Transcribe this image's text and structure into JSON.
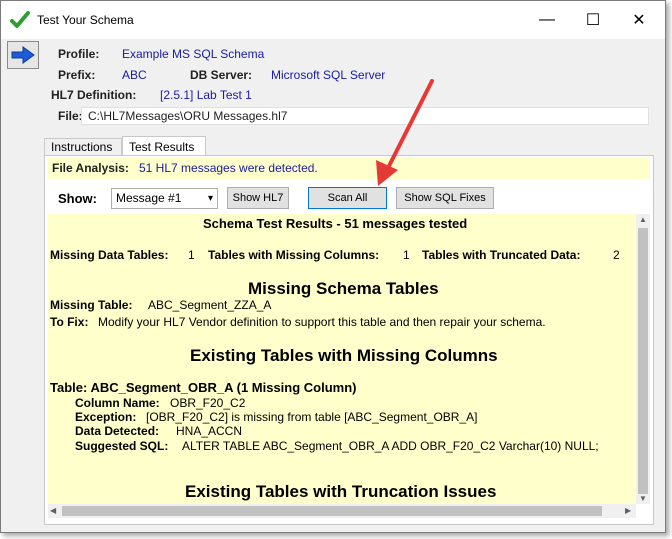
{
  "window": {
    "title": "Test Your Schema",
    "controls": {
      "minimize": "—",
      "maximize": "☐",
      "close": "✕"
    }
  },
  "profile": {
    "profile_label": "Profile:",
    "profile_value": "Example MS SQL Schema",
    "prefix_label": "Prefix:",
    "prefix_value": "ABC",
    "db_server_label": "DB Server:",
    "db_server_value": "Microsoft SQL Server",
    "hl7_def_label": "HL7 Definition:",
    "hl7_def_value": "[2.5.1] Lab Test 1",
    "file_label": "File:",
    "file_value": "C:\\HL7Messages\\ORU Messages.hl7"
  },
  "tabs": [
    {
      "label": "Instructions",
      "active": false
    },
    {
      "label": "Test Results",
      "active": true
    }
  ],
  "analysis": {
    "label": "File Analysis:",
    "value": "51 HL7 messages were detected."
  },
  "controls": {
    "show_label": "Show:",
    "message_select": "Message #1",
    "show_hl7": "Show HL7",
    "scan_all": "Scan All",
    "show_sql_fixes": "Show SQL Fixes"
  },
  "results": {
    "header": "Schema Test Results - 51 messages tested",
    "summary": {
      "missing_tables_label": "Missing Data Tables:",
      "missing_tables_value": "1",
      "missing_columns_label": "Tables with Missing Columns:",
      "missing_columns_value": "1",
      "truncated_label": "Tables with Truncated Data:",
      "truncated_value": "2"
    },
    "missing_schema": {
      "heading": "Missing Schema Tables",
      "table_label": "Missing Table:",
      "table_value": "ABC_Segment_ZZA_A",
      "fix_label": "To Fix:",
      "fix_value": "Modify your HL7 Vendor definition to support this table and then repair your schema."
    },
    "missing_columns": {
      "heading": "Existing Tables with Missing Columns",
      "table_line": "Table: ABC_Segment_OBR_A (1 Missing Column)",
      "column_label": "Column Name:",
      "column_value": "OBR_F20_C2",
      "exception_label": "Exception:",
      "exception_value": "[OBR_F20_C2] is missing from table [ABC_Segment_OBR_A]",
      "data_label": "Data Detected:",
      "data_value": "HNA_ACCN",
      "sql_label": "Suggested SQL:",
      "sql_value": "ALTER TABLE ABC_Segment_OBR_A ADD OBR_F20_C2 Varchar(10) NULL;"
    },
    "truncation": {
      "heading": "Existing Tables with Truncation Issues"
    }
  },
  "colors": {
    "value_blue": "#1a1aa6",
    "highlight_yellow": "#ffffcc",
    "annotation_red": "#e53935",
    "check_green": "#2e9e2e",
    "arrow_blue": "#1e5bd6"
  }
}
